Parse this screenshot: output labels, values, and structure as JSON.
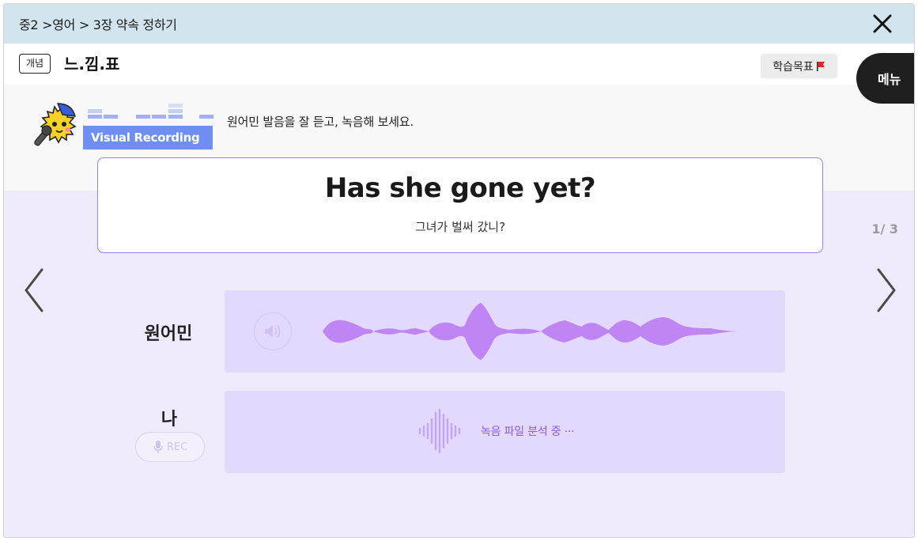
{
  "breadcrumb": "중2 >영어 > 3장 약속 정하기",
  "header": {
    "chip": "개념",
    "title": "느.낌.표",
    "goal_button": "학습목표",
    "menu_button": "메뉴"
  },
  "badge": {
    "label": "Visual Recording"
  },
  "instruction": "원어민 발음을 잘 듣고, 녹음해 보세요.",
  "sentence": {
    "english": "Has she gone yet?",
    "korean": "그녀가 벌써 갔니?"
  },
  "pagination": "1/ 3",
  "rows": {
    "native_label": "원어민",
    "me_label": "나",
    "rec_label": "REC",
    "analyzing_text": "녹음 파일 분석 중 ···"
  },
  "colors": {
    "topbar": "#d2e5ee",
    "lavender_bg": "#efebfd",
    "panel": "#e3d9fc",
    "waveform": "#bf85f5",
    "accent": "#8a5ce8",
    "badge": "#6f8ff0"
  },
  "icons": [
    "close-icon",
    "flag-icon",
    "chevron-left-icon",
    "chevron-right-icon",
    "speaker-icon",
    "microphone-icon",
    "sound-bars-icon"
  ]
}
